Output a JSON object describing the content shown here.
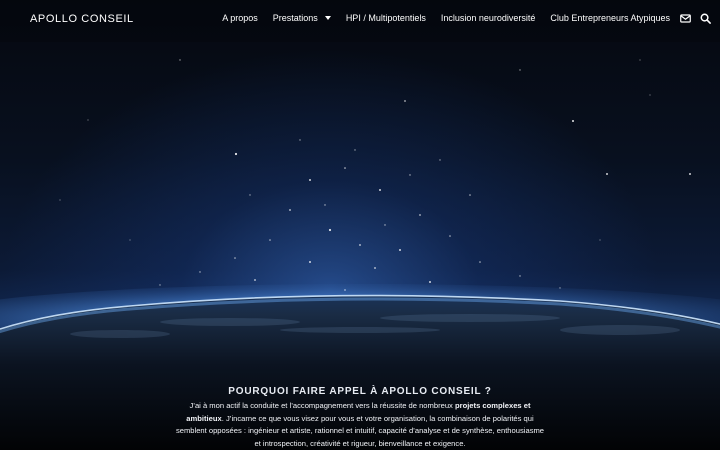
{
  "header": {
    "logo": "APOLLO CONSEIL",
    "nav": [
      {
        "label": "A propos"
      },
      {
        "label": "Prestations",
        "has_dropdown": true
      },
      {
        "label": "HPI / Multipotentiels"
      },
      {
        "label": "Inclusion neurodiversité"
      },
      {
        "label": "Club Entrepreneurs Atypiques"
      }
    ],
    "icons": [
      "envelope-icon",
      "search-icon"
    ]
  },
  "section": {
    "title": "POURQUOI FAIRE APPEL À APOLLO CONSEIL ?",
    "body_part1": "J’ai à mon actif la conduite et l’accompagnement vers la réussite de nombreux ",
    "body_bold": "projets complexes et ambitieux",
    "body_part2": ". J’incarne ce que vous visez pour vous et votre organisation, la combinaison de polarités qui semblent opposées : ingénieur et artiste, rationnel et intuitif, capacité d’analyse et de synthèse, enthousiasme et introspection, créativité et rigueur, bienveillance et exigence."
  },
  "colors": {
    "background": "#000000",
    "text": "#ffffff",
    "horizon_glow": "#4f8ee0"
  }
}
